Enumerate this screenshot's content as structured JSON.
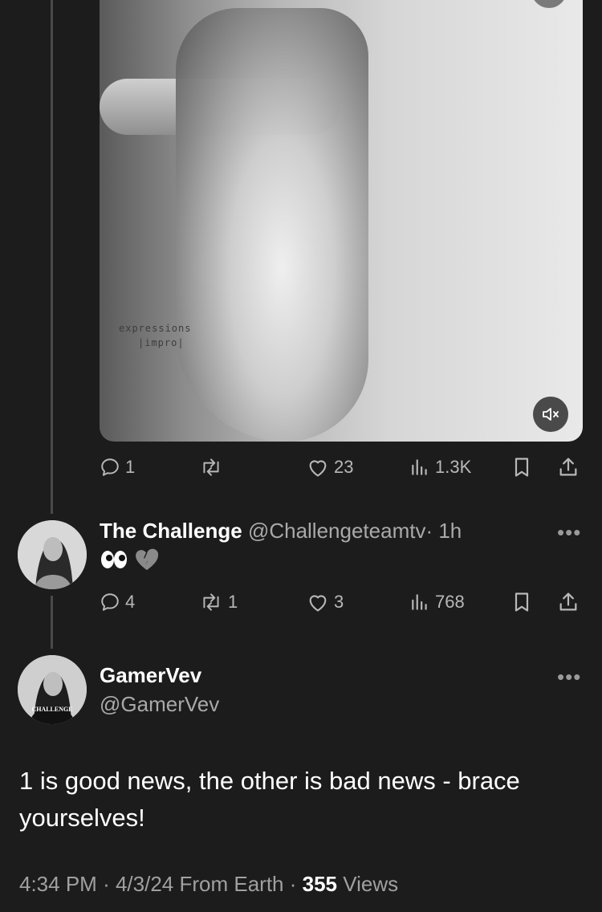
{
  "media": {
    "watermark_line1": "expressions",
    "watermark_line2": "|impro|",
    "mute_icon": "speaker-muted-icon"
  },
  "tweet1_actions": {
    "replies": "1",
    "reposts": "",
    "likes": "23",
    "views": "1.3K"
  },
  "reply": {
    "name": "The Challenge",
    "handle": "@Challengeteamtv",
    "time": "· 1h",
    "body_emojis": [
      "eyes-emoji",
      "broken-heart-emoji"
    ],
    "actions": {
      "replies": "4",
      "reposts": "1",
      "likes": "3",
      "views": "768"
    }
  },
  "main_tweet": {
    "name": "GamerVev",
    "handle": "@GamerVev",
    "avatar_shirt_text": "CHALLENGE",
    "text": "1 is good news, the other is bad news - brace yourselves!",
    "time": "4:34 PM",
    "date": "4/3/24",
    "source": "From Earth",
    "views_count": "355",
    "views_label": "Views"
  },
  "more_label": "•••",
  "colors": {
    "background": "#1c1c1c",
    "text_primary": "#ffffff",
    "text_secondary": "#a9a9a9",
    "thread_line": "#4a4a4a"
  }
}
